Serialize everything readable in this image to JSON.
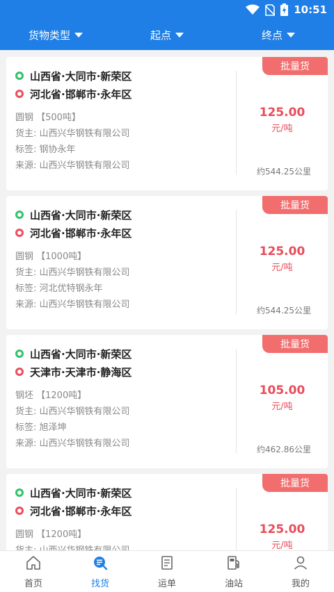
{
  "status": {
    "time": "10:51"
  },
  "filters": [
    {
      "label": "货物类型"
    },
    {
      "label": "起点"
    },
    {
      "label": "终点"
    }
  ],
  "cards": [
    {
      "badge": "批量货",
      "origin": "山西省·大同市·新荣区",
      "destination": "河北省·邯郸市·永年区",
      "cargo": "圆钢 【500吨】",
      "owner": "货主: 山西兴华钢铁有限公司",
      "tags": "标签: 钢协永年",
      "source": "来源: 山西兴华钢铁有限公司",
      "price": "125.00",
      "unit": "元/吨",
      "distance": "约544.25公里"
    },
    {
      "badge": "批量货",
      "origin": "山西省·大同市·新荣区",
      "destination": "河北省·邯郸市·永年区",
      "cargo": "圆钢 【1000吨】",
      "owner": "货主: 山西兴华钢铁有限公司",
      "tags": "标签: 河北优特钢永年",
      "source": "来源: 山西兴华钢铁有限公司",
      "price": "125.00",
      "unit": "元/吨",
      "distance": "约544.25公里"
    },
    {
      "badge": "批量货",
      "origin": "山西省·大同市·新荣区",
      "destination": "天津市·天津市·静海区",
      "cargo": "钢坯 【1200吨】",
      "owner": "货主: 山西兴华钢铁有限公司",
      "tags": "标签: 旭泽坤",
      "source": "来源: 山西兴华钢铁有限公司",
      "price": "105.00",
      "unit": "元/吨",
      "distance": "约462.86公里"
    },
    {
      "badge": "批量货",
      "origin": "山西省·大同市·新荣区",
      "destination": "河北省·邯郸市·永年区",
      "cargo": "圆钢 【1200吨】",
      "owner": "货主: 山西兴华钢铁有限公司",
      "tags": "",
      "source": "",
      "price": "125.00",
      "unit": "元/吨",
      "distance": ""
    }
  ],
  "tabs": [
    {
      "label": "首页",
      "icon": "home-icon"
    },
    {
      "label": "找货",
      "icon": "find-cargo-icon"
    },
    {
      "label": "运单",
      "icon": "waybill-icon"
    },
    {
      "label": "油站",
      "icon": "gas-station-icon"
    },
    {
      "label": "我的",
      "icon": "profile-icon"
    }
  ],
  "colors": {
    "primary": "#1f7fe6",
    "price": "#e84c5a",
    "badge": "#f26d6d",
    "origin_dot": "#33c26a",
    "destination_dot": "#ea4f5d"
  }
}
